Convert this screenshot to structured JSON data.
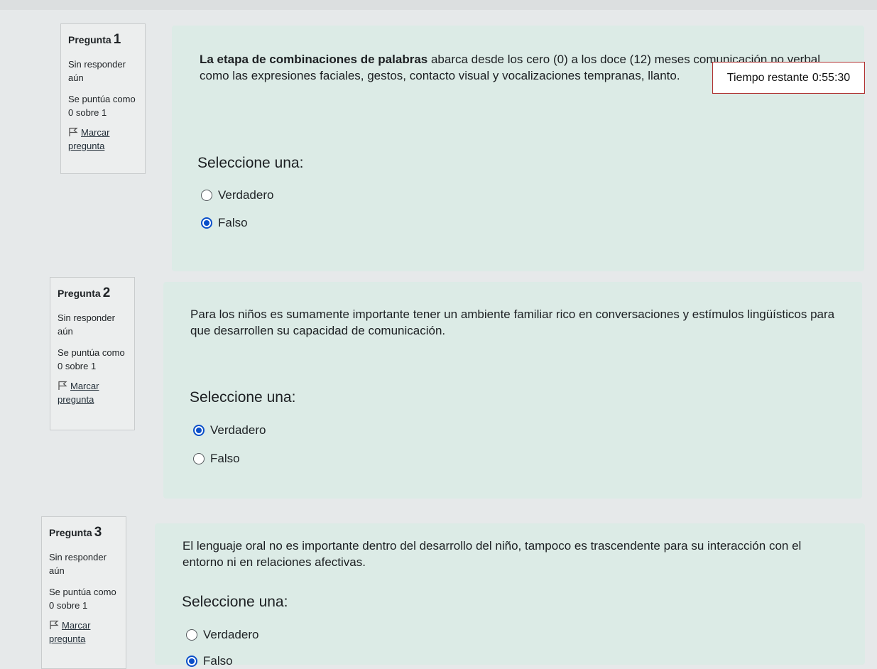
{
  "timer": {
    "label": "Tiempo restante",
    "value": "0:55:30"
  },
  "questions": [
    {
      "title": "Pregunta",
      "number": "1",
      "state": "Sin responder aún",
      "grade_label": "Se puntúa como",
      "grade_value": "0 sobre 1",
      "flag_label": "Marcar pregunta",
      "text_bold": "La etapa de combinaciones de palabras",
      "text_rest": " abarca desde los cero (0) a los doce (12) meses comunicación no verbal como las expresiones faciales, gestos, contacto visual y vocalizaciones tempranas, llanto.",
      "prompt": "Seleccione una:",
      "options": [
        {
          "label": "Verdadero",
          "selected": false
        },
        {
          "label": "Falso",
          "selected": true
        }
      ]
    },
    {
      "title": "Pregunta",
      "number": "2",
      "state": "Sin responder aún",
      "grade_label": "Se puntúa como",
      "grade_value": "0 sobre 1",
      "flag_label": "Marcar pregunta",
      "text": "Para los niños es sumamente importante tener un ambiente familiar rico en conversaciones y estímulos lingüísticos para que desarrollen su capacidad de comunicación.",
      "prompt": "Seleccione una:",
      "options": [
        {
          "label": "Verdadero",
          "selected": true
        },
        {
          "label": "Falso",
          "selected": false
        }
      ]
    },
    {
      "title": "Pregunta",
      "number": "3",
      "state": "Sin responder aún",
      "grade_label": "Se puntúa como",
      "grade_value": "0 sobre 1",
      "flag_label": "Marcar pregunta",
      "text": "El lenguaje oral no es importante dentro del desarrollo del niño, tampoco es trascendente para su interacción con el entorno ni en relaciones afectivas.",
      "prompt": "Seleccione una:",
      "options": [
        {
          "label": "Verdadero",
          "selected": false
        },
        {
          "label": "Falso",
          "selected": true
        }
      ]
    }
  ]
}
